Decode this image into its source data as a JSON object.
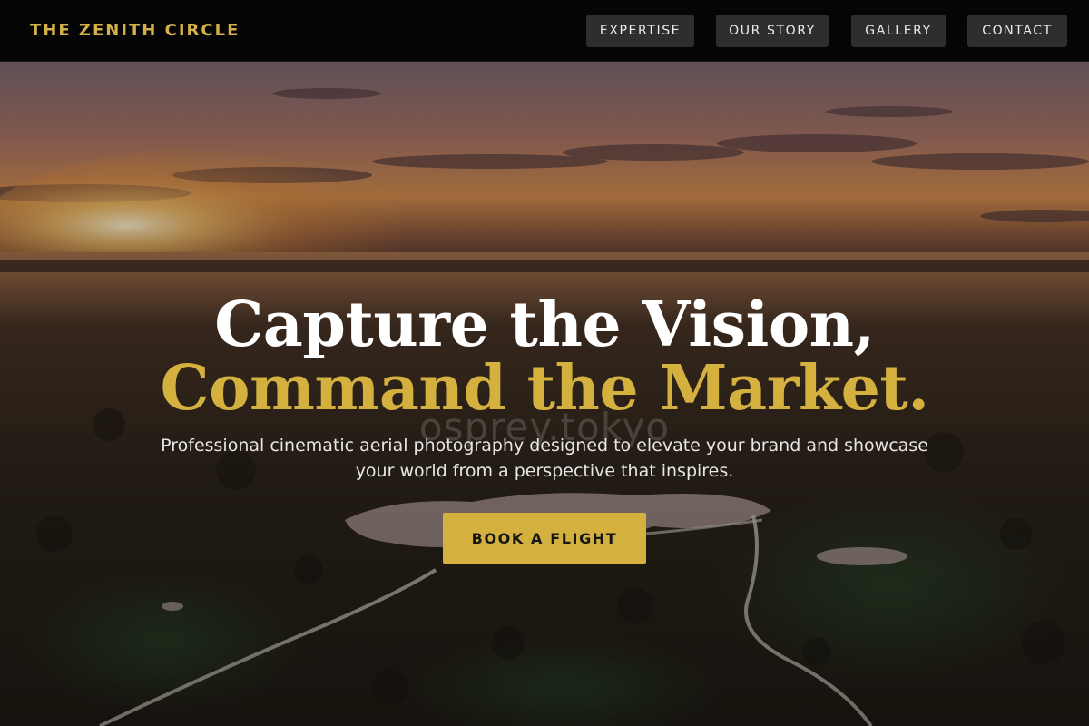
{
  "nav": {
    "brand": "THE ZENITH CIRCLE",
    "links": [
      {
        "label": "EXPERTISE"
      },
      {
        "label": "OUR STORY"
      },
      {
        "label": "GALLERY"
      },
      {
        "label": "CONTACT"
      }
    ]
  },
  "hero": {
    "headline_line1": "Capture the Vision,",
    "headline_line2": "Command the Market.",
    "watermark": "osprey.tokyo",
    "subtitle": "Professional cinematic aerial photography designed to elevate your brand and showcase your world from a perspective that inspires.",
    "cta_label": "BOOK A FLIGHT",
    "background_image": "aerial sunset over wetland with boardwalk path"
  },
  "colors": {
    "accent_gold": "#d4b03f",
    "nav_background": "#050505",
    "nav_button": "#2e2e2e"
  }
}
